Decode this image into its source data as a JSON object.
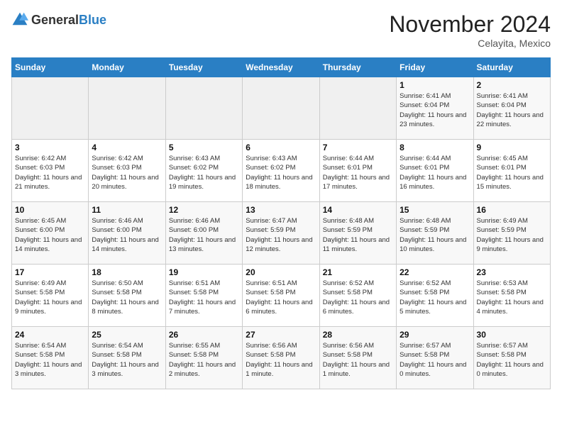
{
  "logo": {
    "general": "General",
    "blue": "Blue"
  },
  "header": {
    "month": "November 2024",
    "location": "Celayita, Mexico"
  },
  "days_of_week": [
    "Sunday",
    "Monday",
    "Tuesday",
    "Wednesday",
    "Thursday",
    "Friday",
    "Saturday"
  ],
  "weeks": [
    [
      {
        "day": "",
        "sunrise": "",
        "sunset": "",
        "daylight": ""
      },
      {
        "day": "",
        "sunrise": "",
        "sunset": "",
        "daylight": ""
      },
      {
        "day": "",
        "sunrise": "",
        "sunset": "",
        "daylight": ""
      },
      {
        "day": "",
        "sunrise": "",
        "sunset": "",
        "daylight": ""
      },
      {
        "day": "",
        "sunrise": "",
        "sunset": "",
        "daylight": ""
      },
      {
        "day": "1",
        "sunrise": "Sunrise: 6:41 AM",
        "sunset": "Sunset: 6:04 PM",
        "daylight": "Daylight: 11 hours and 23 minutes."
      },
      {
        "day": "2",
        "sunrise": "Sunrise: 6:41 AM",
        "sunset": "Sunset: 6:04 PM",
        "daylight": "Daylight: 11 hours and 22 minutes."
      }
    ],
    [
      {
        "day": "3",
        "sunrise": "Sunrise: 6:42 AM",
        "sunset": "Sunset: 6:03 PM",
        "daylight": "Daylight: 11 hours and 21 minutes."
      },
      {
        "day": "4",
        "sunrise": "Sunrise: 6:42 AM",
        "sunset": "Sunset: 6:03 PM",
        "daylight": "Daylight: 11 hours and 20 minutes."
      },
      {
        "day": "5",
        "sunrise": "Sunrise: 6:43 AM",
        "sunset": "Sunset: 6:02 PM",
        "daylight": "Daylight: 11 hours and 19 minutes."
      },
      {
        "day": "6",
        "sunrise": "Sunrise: 6:43 AM",
        "sunset": "Sunset: 6:02 PM",
        "daylight": "Daylight: 11 hours and 18 minutes."
      },
      {
        "day": "7",
        "sunrise": "Sunrise: 6:44 AM",
        "sunset": "Sunset: 6:01 PM",
        "daylight": "Daylight: 11 hours and 17 minutes."
      },
      {
        "day": "8",
        "sunrise": "Sunrise: 6:44 AM",
        "sunset": "Sunset: 6:01 PM",
        "daylight": "Daylight: 11 hours and 16 minutes."
      },
      {
        "day": "9",
        "sunrise": "Sunrise: 6:45 AM",
        "sunset": "Sunset: 6:01 PM",
        "daylight": "Daylight: 11 hours and 15 minutes."
      }
    ],
    [
      {
        "day": "10",
        "sunrise": "Sunrise: 6:45 AM",
        "sunset": "Sunset: 6:00 PM",
        "daylight": "Daylight: 11 hours and 14 minutes."
      },
      {
        "day": "11",
        "sunrise": "Sunrise: 6:46 AM",
        "sunset": "Sunset: 6:00 PM",
        "daylight": "Daylight: 11 hours and 14 minutes."
      },
      {
        "day": "12",
        "sunrise": "Sunrise: 6:46 AM",
        "sunset": "Sunset: 6:00 PM",
        "daylight": "Daylight: 11 hours and 13 minutes."
      },
      {
        "day": "13",
        "sunrise": "Sunrise: 6:47 AM",
        "sunset": "Sunset: 5:59 PM",
        "daylight": "Daylight: 11 hours and 12 minutes."
      },
      {
        "day": "14",
        "sunrise": "Sunrise: 6:48 AM",
        "sunset": "Sunset: 5:59 PM",
        "daylight": "Daylight: 11 hours and 11 minutes."
      },
      {
        "day": "15",
        "sunrise": "Sunrise: 6:48 AM",
        "sunset": "Sunset: 5:59 PM",
        "daylight": "Daylight: 11 hours and 10 minutes."
      },
      {
        "day": "16",
        "sunrise": "Sunrise: 6:49 AM",
        "sunset": "Sunset: 5:59 PM",
        "daylight": "Daylight: 11 hours and 9 minutes."
      }
    ],
    [
      {
        "day": "17",
        "sunrise": "Sunrise: 6:49 AM",
        "sunset": "Sunset: 5:58 PM",
        "daylight": "Daylight: 11 hours and 9 minutes."
      },
      {
        "day": "18",
        "sunrise": "Sunrise: 6:50 AM",
        "sunset": "Sunset: 5:58 PM",
        "daylight": "Daylight: 11 hours and 8 minutes."
      },
      {
        "day": "19",
        "sunrise": "Sunrise: 6:51 AM",
        "sunset": "Sunset: 5:58 PM",
        "daylight": "Daylight: 11 hours and 7 minutes."
      },
      {
        "day": "20",
        "sunrise": "Sunrise: 6:51 AM",
        "sunset": "Sunset: 5:58 PM",
        "daylight": "Daylight: 11 hours and 6 minutes."
      },
      {
        "day": "21",
        "sunrise": "Sunrise: 6:52 AM",
        "sunset": "Sunset: 5:58 PM",
        "daylight": "Daylight: 11 hours and 6 minutes."
      },
      {
        "day": "22",
        "sunrise": "Sunrise: 6:52 AM",
        "sunset": "Sunset: 5:58 PM",
        "daylight": "Daylight: 11 hours and 5 minutes."
      },
      {
        "day": "23",
        "sunrise": "Sunrise: 6:53 AM",
        "sunset": "Sunset: 5:58 PM",
        "daylight": "Daylight: 11 hours and 4 minutes."
      }
    ],
    [
      {
        "day": "24",
        "sunrise": "Sunrise: 6:54 AM",
        "sunset": "Sunset: 5:58 PM",
        "daylight": "Daylight: 11 hours and 3 minutes."
      },
      {
        "day": "25",
        "sunrise": "Sunrise: 6:54 AM",
        "sunset": "Sunset: 5:58 PM",
        "daylight": "Daylight: 11 hours and 3 minutes."
      },
      {
        "day": "26",
        "sunrise": "Sunrise: 6:55 AM",
        "sunset": "Sunset: 5:58 PM",
        "daylight": "Daylight: 11 hours and 2 minutes."
      },
      {
        "day": "27",
        "sunrise": "Sunrise: 6:56 AM",
        "sunset": "Sunset: 5:58 PM",
        "daylight": "Daylight: 11 hours and 1 minute."
      },
      {
        "day": "28",
        "sunrise": "Sunrise: 6:56 AM",
        "sunset": "Sunset: 5:58 PM",
        "daylight": "Daylight: 11 hours and 1 minute."
      },
      {
        "day": "29",
        "sunrise": "Sunrise: 6:57 AM",
        "sunset": "Sunset: 5:58 PM",
        "daylight": "Daylight: 11 hours and 0 minutes."
      },
      {
        "day": "30",
        "sunrise": "Sunrise: 6:57 AM",
        "sunset": "Sunset: 5:58 PM",
        "daylight": "Daylight: 11 hours and 0 minutes."
      }
    ]
  ]
}
